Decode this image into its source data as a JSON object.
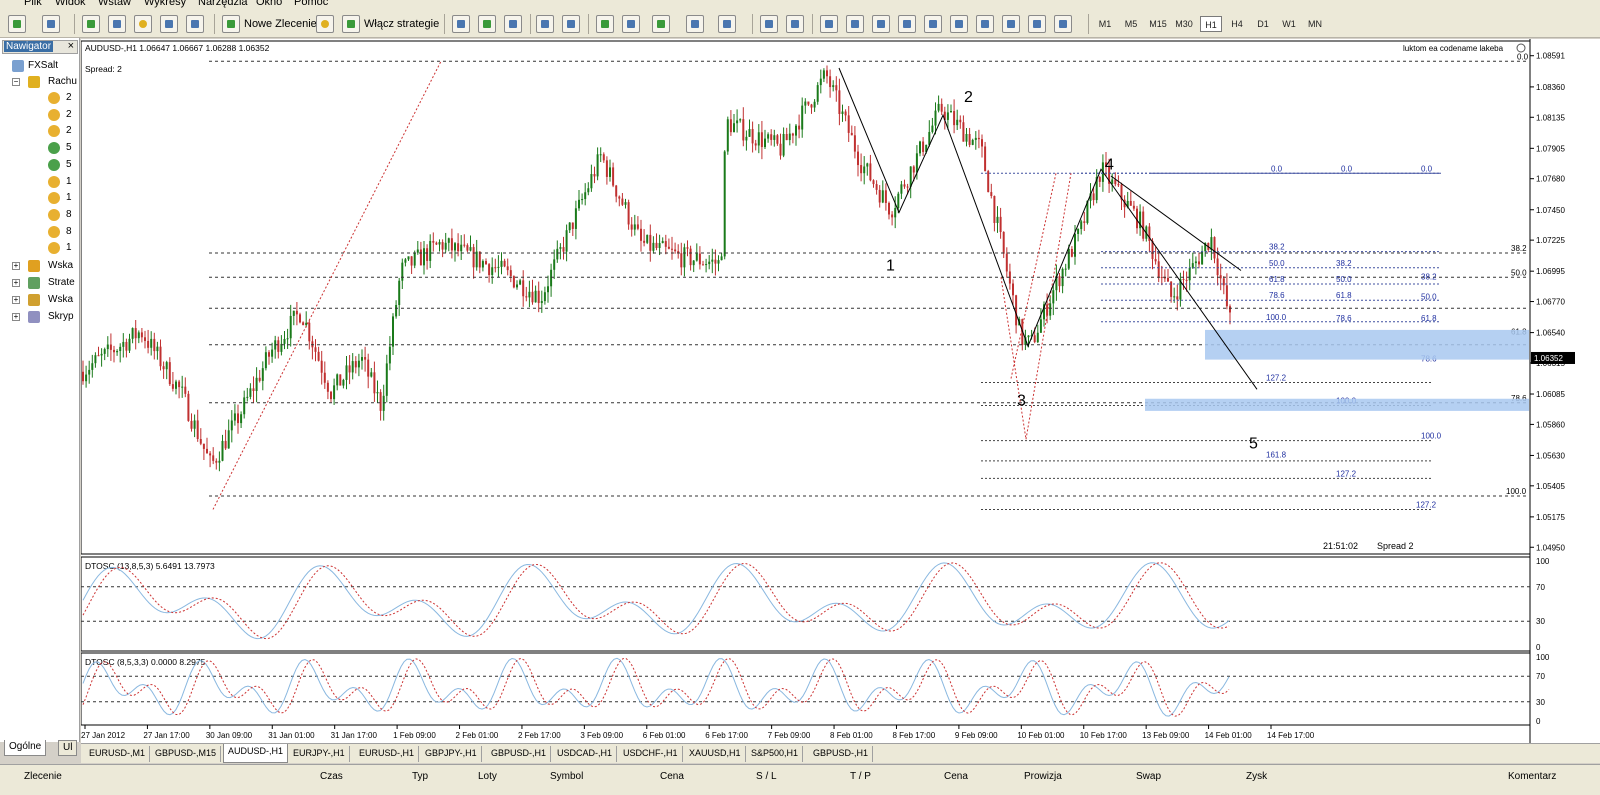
{
  "menu": [
    "Plik",
    "Widok",
    "Wstaw",
    "Wykresy",
    "Narzędzia",
    "Okno",
    "Pomoc"
  ],
  "toolbar": {
    "new_order_label": "Nowe Zlecenie",
    "strategies_label": "Włącz strategie",
    "timeframes": [
      "M1",
      "M5",
      "M15",
      "M30",
      "H1",
      "H4",
      "D1",
      "W1",
      "MN"
    ],
    "active_timeframe": "H1"
  },
  "navigator": {
    "title": "Nawigator",
    "close": "×",
    "root": "FXSalt",
    "accounts_label": "Rachu",
    "accounts": [
      "2",
      "2",
      "2",
      "5",
      "5",
      "1",
      "1",
      "8",
      "8",
      "1"
    ],
    "groups": [
      "Wska",
      "Strate",
      "Wska",
      "Skryp"
    ],
    "tabs": [
      "Ogólne",
      "Ul"
    ]
  },
  "chart": {
    "header": "AUDUSD-,H1  1.06647 1.06667 1.06288 1.06352",
    "spread_label": "Spread: 2",
    "ea_label": "luktom ea codename lakeba",
    "current_price": "1.06352",
    "price_ticks": [
      "1.08591",
      "1.08360",
      "1.08135",
      "1.07905",
      "1.07680",
      "1.07450",
      "1.07225",
      "1.06995",
      "1.06770",
      "1.06540",
      "1.06315",
      "1.06085",
      "1.05860",
      "1.05630",
      "1.05405",
      "1.05175",
      "1.04950"
    ],
    "time_ticks": [
      "27 Jan 2012",
      "27 Jan 17:00",
      "30 Jan 09:00",
      "31 Jan 01:00",
      "31 Jan 17:00",
      "1 Feb 09:00",
      "2 Feb 01:00",
      "2 Feb 17:00",
      "3 Feb 09:00",
      "6 Feb 01:00",
      "6 Feb 17:00",
      "7 Feb 09:00",
      "8 Feb 01:00",
      "8 Feb 17:00",
      "9 Feb 09:00",
      "10 Feb 01:00",
      "10 Feb 17:00",
      "13 Feb 09:00",
      "14 Feb 01:00",
      "14 Feb 17:00"
    ],
    "wave_labels": [
      "1",
      "2",
      "3",
      "4",
      "5"
    ],
    "fib_labels": [
      "0.0",
      "38.2",
      "50.0",
      "61.8",
      "78.6",
      "100.0",
      "127.2",
      "161.8"
    ],
    "clock": "21:51:02",
    "spread_bottom": "Spread  2",
    "accent_colors": {
      "bull": "#1a7a1a",
      "bear": "#c03030",
      "fib_zone": "#a8c8f0",
      "signal": "#cc3333",
      "osc": "#8ab8e0"
    }
  },
  "oscillators": [
    {
      "label": "DTOSC (13,8,5,3) 5.6491 13.7973",
      "levels": [
        "100",
        "70",
        "30",
        "0"
      ]
    },
    {
      "label": "DTOSC (8,5,3,3) 0.0000 8.2975",
      "levels": [
        "100",
        "70",
        "30",
        "0"
      ]
    }
  ],
  "symbol_tabs": [
    "EURUSD-,M1",
    "GBPUSD-,M15",
    "AUDUSD-,H1",
    "EURJPY-,H1",
    "EURUSD-,H1",
    "GBPJPY-,H1",
    "GBPUSD-,H1",
    "USDCAD-,H1",
    "USDCHF-,H1",
    "XAUUSD,H1",
    "S&P500,H1",
    "GBPUSD-,H1"
  ],
  "active_symbol_tab": 2,
  "terminal_columns": [
    "Zlecenie",
    "Czas",
    "Typ",
    "Loty",
    "Symbol",
    "Cena",
    "S / L",
    "T / P",
    "Cena",
    "Prowizja",
    "Swap",
    "Zysk",
    "Komentarz"
  ]
}
